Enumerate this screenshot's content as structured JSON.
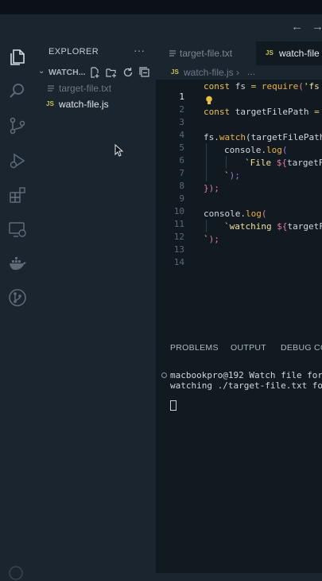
{
  "explorer": {
    "title": "EXPLORER",
    "more": "···",
    "folder": "WATCH...",
    "files": [
      {
        "name": "target-file.txt",
        "icon": "lines-icon",
        "state": "dim"
      },
      {
        "name": "watch-file.js",
        "icon": "js-icon",
        "badge": "JS",
        "state": "active"
      }
    ]
  },
  "nav": {
    "back": "←",
    "forward": "→"
  },
  "tabs": [
    {
      "label": "target-file.txt",
      "active": false
    },
    {
      "label": "watch-file",
      "badge": "JS",
      "active": true
    }
  ],
  "breadcrumb": {
    "badge": "JS",
    "file": "watch-file.js",
    "separator": "›",
    "ellipsis": "..."
  },
  "editor": {
    "line_numbers": [
      "1",
      "2",
      "3",
      "4",
      "5",
      "6",
      "7",
      "8",
      "9",
      "10",
      "11",
      "12",
      "13",
      "14"
    ],
    "lines": [
      {
        "t1": "const",
        "t2": " fs ",
        "t3": "=",
        "t4": " ",
        "t5": "require",
        "t6": "(",
        "t7": "'fs"
      },
      {},
      {
        "t1": "const",
        "t2": " targetFilePath ",
        "t3": "="
      },
      {},
      {
        "t1": "fs.",
        "t2": "watch",
        "t3": "(targetFilePath"
      },
      {
        "t1": "console.",
        "t2": "log",
        "t3": "("
      },
      {
        "t1": "`File ",
        "t2": "${",
        "t3": "targetF"
      },
      {
        "t1": "`",
        "t2": ");"
      },
      {
        "t1": "});"
      },
      {},
      {
        "t1": "console.",
        "t2": "log",
        "t3": "("
      },
      {
        "t1": "`watching ",
        "t2": "${",
        "t3": "targetFil"
      },
      {
        "t1": "`",
        "t2": ");"
      },
      {}
    ]
  },
  "panel": {
    "tabs": [
      "PROBLEMS",
      "OUTPUT",
      "DEBUG CO"
    ],
    "terminal": [
      "macbookpro@192 Watch file for",
      "watching ./target-file.txt for"
    ]
  },
  "colors": {
    "background": "#1b2530",
    "editor": "#121a21",
    "keyword": "#e8c15c",
    "string": "#ede0a1",
    "js_badge": "#c9c24a"
  }
}
